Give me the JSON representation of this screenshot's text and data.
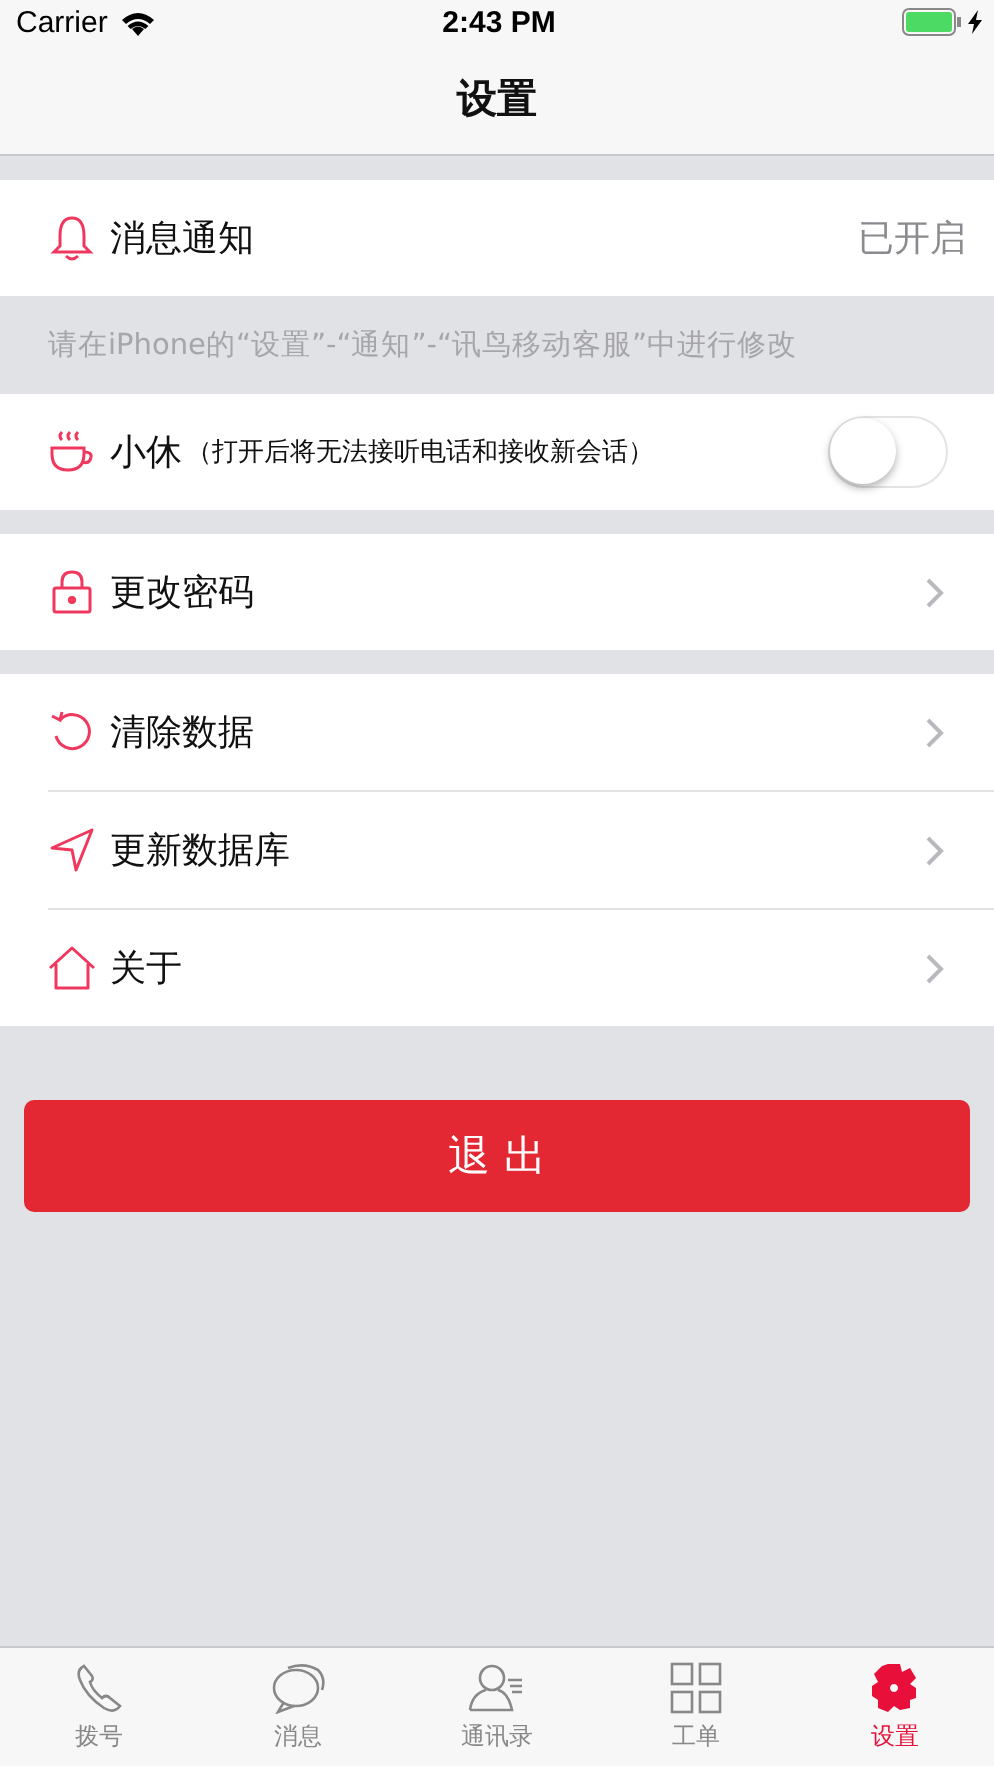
{
  "status_bar": {
    "carrier": "Carrier",
    "time": "2:43 PM"
  },
  "nav": {
    "title": "设置"
  },
  "sections": [
    {
      "rows": [
        {
          "kind": "value",
          "label": "消息通知",
          "value": "已开启"
        }
      ],
      "footer": "请在iPhone的“设置”-“通知”-“讯鸟移动客服”中进行修改"
    },
    {
      "rows": [
        {
          "kind": "toggle",
          "label": "小休",
          "note": "（打开后将无法接听电话和接收新会话）",
          "on": false
        }
      ]
    },
    {
      "rows": [
        {
          "kind": "link",
          "label": "更改密码"
        }
      ]
    },
    {
      "rows": [
        {
          "kind": "link",
          "label": "清除数据"
        },
        {
          "kind": "link",
          "label": "更新数据库"
        },
        {
          "kind": "link",
          "label": "关于"
        }
      ]
    }
  ],
  "logout_button": "退 出",
  "tabs": [
    {
      "label": "拨号",
      "selected": false
    },
    {
      "label": "消息",
      "selected": false
    },
    {
      "label": "通讯录",
      "selected": false
    },
    {
      "label": "工单",
      "selected": false
    },
    {
      "label": "设置",
      "selected": true
    }
  ]
}
